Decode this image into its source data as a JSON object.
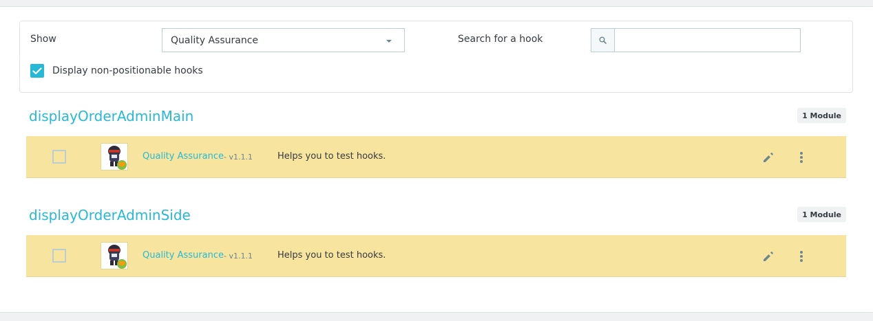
{
  "filters": {
    "show_label": "Show",
    "show_selected": "Quality Assurance",
    "search_label": "Search for a hook",
    "search_value": "",
    "search_placeholder": "",
    "non_positionable_label": "Display non-positionable hooks",
    "non_positionable_checked": true
  },
  "hooks": [
    {
      "name": "displayOrderAdminMain",
      "badge": "1 Module",
      "modules": [
        {
          "name": "Quality Assurance",
          "version": "- v1.1.1",
          "description": "Helps you to test hooks."
        }
      ]
    },
    {
      "name": "displayOrderAdminSide",
      "badge": "1 Module",
      "modules": [
        {
          "name": "Quality Assurance",
          "version": "- v1.1.1",
          "description": "Helps you to test hooks."
        }
      ]
    }
  ],
  "colors": {
    "accent": "#25b9d7",
    "row_highlight": "#f6e49f",
    "text": "#363a41"
  },
  "icons": {
    "search": "search-icon",
    "check": "check-icon",
    "edit": "pencil-icon",
    "more": "more-vertical-icon"
  }
}
